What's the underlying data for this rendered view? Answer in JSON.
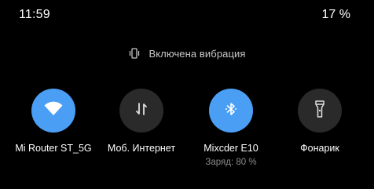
{
  "status_bar": {
    "time": "11:59",
    "battery": "17 %"
  },
  "vibration": {
    "label": "Включена вибрация",
    "icon": "vibrate-icon"
  },
  "tiles": [
    {
      "label": "Mi Router ST_5G",
      "icon": "wifi-icon",
      "active": true
    },
    {
      "label": "Моб. Интернет",
      "icon": "mobile-data-icon",
      "active": false
    },
    {
      "label": "Mixcder E10",
      "sublabel": "Заряд: 80 %",
      "icon": "bluetooth-icon",
      "active": true
    },
    {
      "label": "Фонарик",
      "icon": "flashlight-icon",
      "active": false
    }
  ],
  "colors": {
    "background": "#000000",
    "active_tile": "#4a9ff5",
    "inactive_tile": "#2a2a2a",
    "secondary_text": "#8a8a8a"
  }
}
